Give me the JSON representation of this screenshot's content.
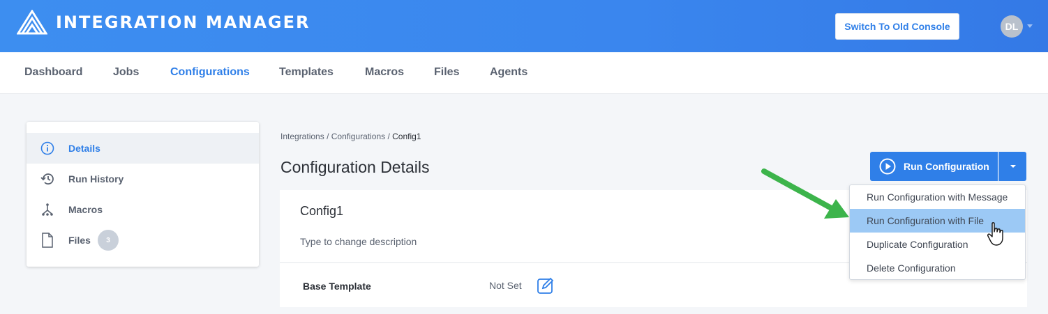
{
  "app": {
    "title": "INTEGRATION MANAGER",
    "switch_button": "Switch To Old Console",
    "avatar_initials": "DL"
  },
  "nav": {
    "items": [
      {
        "label": "Dashboard"
      },
      {
        "label": "Jobs"
      },
      {
        "label": "Configurations",
        "active": true
      },
      {
        "label": "Templates"
      },
      {
        "label": "Macros"
      },
      {
        "label": "Files"
      },
      {
        "label": "Agents"
      }
    ]
  },
  "sidebar": {
    "items": [
      {
        "label": "Details",
        "icon": "info-icon",
        "active": true
      },
      {
        "label": "Run History",
        "icon": "history-icon"
      },
      {
        "label": "Macros",
        "icon": "macros-icon"
      },
      {
        "label": "Files",
        "icon": "file-icon",
        "count": "3"
      }
    ]
  },
  "breadcrumb": {
    "parts": [
      "Integrations",
      "Configurations"
    ],
    "separator": "/",
    "current": "Config1"
  },
  "page": {
    "title": "Configuration Details"
  },
  "run_button": {
    "label": "Run Configuration"
  },
  "dropdown": {
    "items": [
      {
        "label": "Run Configuration with Message"
      },
      {
        "label": "Run Configuration with File",
        "hovered": true
      },
      {
        "label": "Duplicate Configuration"
      },
      {
        "label": "Delete Configuration"
      }
    ]
  },
  "config": {
    "name": "Config1",
    "description_placeholder": "Type to change description",
    "base_template_label": "Base Template",
    "base_template_value": "Not Set"
  },
  "colors": {
    "accent": "#2f7fe8",
    "header": "#3d8ef0",
    "hover": "#9cc9f5",
    "annotation_arrow": "#3cb44b"
  }
}
